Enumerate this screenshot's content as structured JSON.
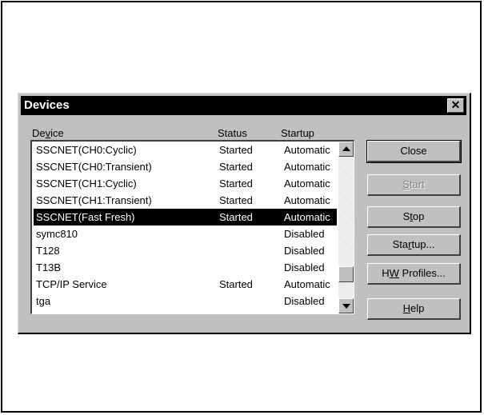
{
  "dialog": {
    "title": "Devices",
    "close_glyph": "✕"
  },
  "columns": {
    "device": {
      "pre": "De",
      "accel": "v",
      "post": "ice"
    },
    "status": "Status",
    "startup": "Startup"
  },
  "rows": [
    {
      "device": "SSCNET(CH0:Cyclic)",
      "status": "Started",
      "startup": "Automatic"
    },
    {
      "device": "SSCNET(CH0:Transient)",
      "status": "Started",
      "startup": "Automatic"
    },
    {
      "device": "SSCNET(CH1:Cyclic)",
      "status": "Started",
      "startup": "Automatic"
    },
    {
      "device": "SSCNET(CH1:Transient)",
      "status": "Started",
      "startup": "Automatic"
    },
    {
      "device": "SSCNET(Fast Fresh)",
      "status": "Started",
      "startup": "Automatic"
    },
    {
      "device": "symc810",
      "status": "",
      "startup": "Disabled"
    },
    {
      "device": "T128",
      "status": "",
      "startup": "Disabled"
    },
    {
      "device": "T13B",
      "status": "",
      "startup": "Disabled"
    },
    {
      "device": "TCP/IP Service",
      "status": "Started",
      "startup": "Automatic"
    },
    {
      "device": "tga",
      "status": "",
      "startup": "Disabled"
    }
  ],
  "selected_row": "SSCNET(Fast Fresh)",
  "buttons": {
    "close": {
      "pre": "Close",
      "accel": "",
      "post": ""
    },
    "start": {
      "pre": "",
      "accel": "S",
      "post": "tart"
    },
    "stop": {
      "pre": "S",
      "accel": "t",
      "post": "op"
    },
    "startup": {
      "pre": "Sta",
      "accel": "r",
      "post": "tup..."
    },
    "hw_profiles": {
      "pre": "H",
      "accel": "W",
      "post": " Profiles..."
    },
    "help": {
      "pre": "",
      "accel": "H",
      "post": "elp"
    }
  }
}
